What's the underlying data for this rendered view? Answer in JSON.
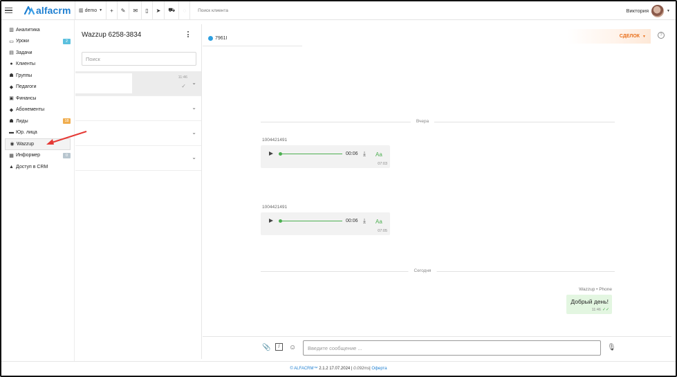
{
  "topbar": {
    "logo_text": "alfacrm",
    "branch": "demo",
    "tools": [
      "+",
      "✎",
      "✉",
      "▯",
      "➤",
      "⛟",
      "◌"
    ],
    "search_placeholder": "Поиск клиента",
    "user_name": "Виктория"
  },
  "sidebar": {
    "items": [
      {
        "label": "Аналитика",
        "icon": "chart-icon"
      },
      {
        "label": "Уроки",
        "icon": "calendar-icon",
        "badge": "2",
        "badge_color": "#5bc0de"
      },
      {
        "label": "Задачи",
        "icon": "tasks-icon"
      },
      {
        "label": "Клиенты",
        "icon": "user-icon"
      },
      {
        "label": "Группы",
        "icon": "group-icon"
      },
      {
        "label": "Педагоги",
        "icon": "teacher-icon"
      },
      {
        "label": "Финансы",
        "icon": "money-icon"
      },
      {
        "label": "Абонементы",
        "icon": "tag-icon"
      },
      {
        "label": "Лиды",
        "icon": "lead-icon",
        "badge": "18",
        "badge_color": "#f0ad4e"
      },
      {
        "label": "Юр. лица",
        "icon": "briefcase-icon"
      },
      {
        "label": "Wazzup",
        "icon": "whatsapp-icon",
        "active": true
      },
      {
        "label": "Информер",
        "icon": "inform-icon",
        "badge": "0",
        "badge_color": "#b8c6cf"
      },
      {
        "label": "Доступ в CRM",
        "icon": "lock-icon"
      }
    ]
  },
  "chatlist": {
    "title": "Wazzup 6258-3834",
    "search_placeholder": "Поиск",
    "rows": [
      {
        "time": "11:46"
      }
    ]
  },
  "chat": {
    "phone": "7961I",
    "deals_label": "СДЕЛОК",
    "divider_yesterday": "Вчера",
    "divider_today": "Сегодня",
    "audio_messages": [
      {
        "sender": "1004421491",
        "duration": "00:06",
        "aa": "Аа",
        "time": "07:03"
      },
      {
        "sender": "1004421491",
        "duration": "00:06",
        "aa": "Аа",
        "time": "07:05"
      }
    ],
    "outgoing": {
      "sender": "Wazzup • Phone",
      "text": "Добрый день!",
      "time": "11:46"
    },
    "composer_placeholder": "Введите сообщение ..."
  },
  "footer": {
    "brand": "© ALFACRM™",
    "version": "2.1.2",
    "date": "17.07.2024",
    "sep1": "|",
    "timing": "0.092ms",
    "sep2": "|",
    "offer": "Оферта"
  },
  "colors": {
    "accent": "#1e7fd1",
    "green": "#4caf50",
    "orange": "#e96e18",
    "annotation_arrow": "#e53935"
  }
}
